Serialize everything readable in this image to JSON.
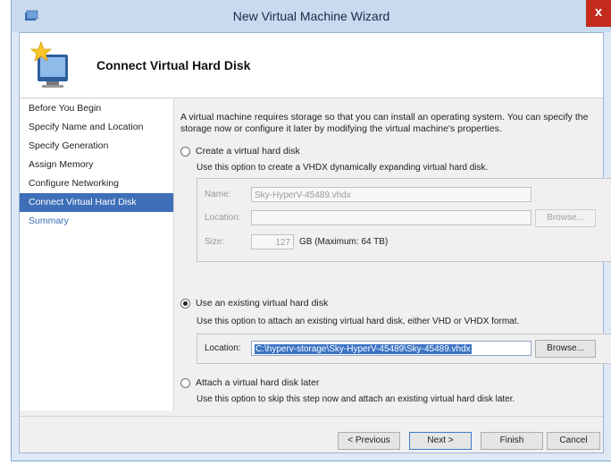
{
  "window": {
    "title": "New Virtual Machine Wizard",
    "close_glyph": "x",
    "icon": "hyper-v-app-icon"
  },
  "header": {
    "title": "Connect Virtual Hard Disk",
    "icon": "new-vm-wizard-icon"
  },
  "nav": {
    "items": [
      {
        "label": "Before You Begin"
      },
      {
        "label": "Specify Name and Location"
      },
      {
        "label": "Specify Generation"
      },
      {
        "label": "Assign Memory"
      },
      {
        "label": "Configure Networking"
      },
      {
        "label": "Connect Virtual Hard Disk"
      },
      {
        "label": "Summary"
      }
    ],
    "active_index": 5
  },
  "content": {
    "description": "A virtual machine requires storage so that you can install an operating system. You can specify the storage now or configure it later by modifying the virtual machine's properties.",
    "create": {
      "label": "Create a virtual hard disk",
      "desc": "Use this option to create a VHDX dynamically expanding virtual hard disk.",
      "name_label": "Name:",
      "name_value": "Sky-HyperV-45489.vhdx",
      "location_label": "Location:",
      "location_value": "",
      "browse_label": "Browse...",
      "size_label": "Size:",
      "size_value": "127",
      "size_unit": "GB (Maximum: 64 TB)"
    },
    "existing": {
      "label": "Use an existing virtual hard disk",
      "desc": "Use this option to attach an existing virtual hard disk, either VHD or VHDX format.",
      "location_label": "Location:",
      "location_value": "C:\\hyperv-storage\\Sky-HyperV-45489\\Sky-45489.vhdx",
      "browse_label": "Browse..."
    },
    "later": {
      "label": "Attach a virtual hard disk later",
      "desc": "Use this option to skip this step now and attach an existing virtual hard disk later."
    },
    "selected_option": "existing"
  },
  "footer": {
    "previous": "< Previous",
    "next": "Next >",
    "finish": "Finish",
    "cancel": "Cancel"
  },
  "colors": {
    "accent": "#3e6fb8",
    "link": "#3a6fb6",
    "selection": "#3b73c4"
  }
}
